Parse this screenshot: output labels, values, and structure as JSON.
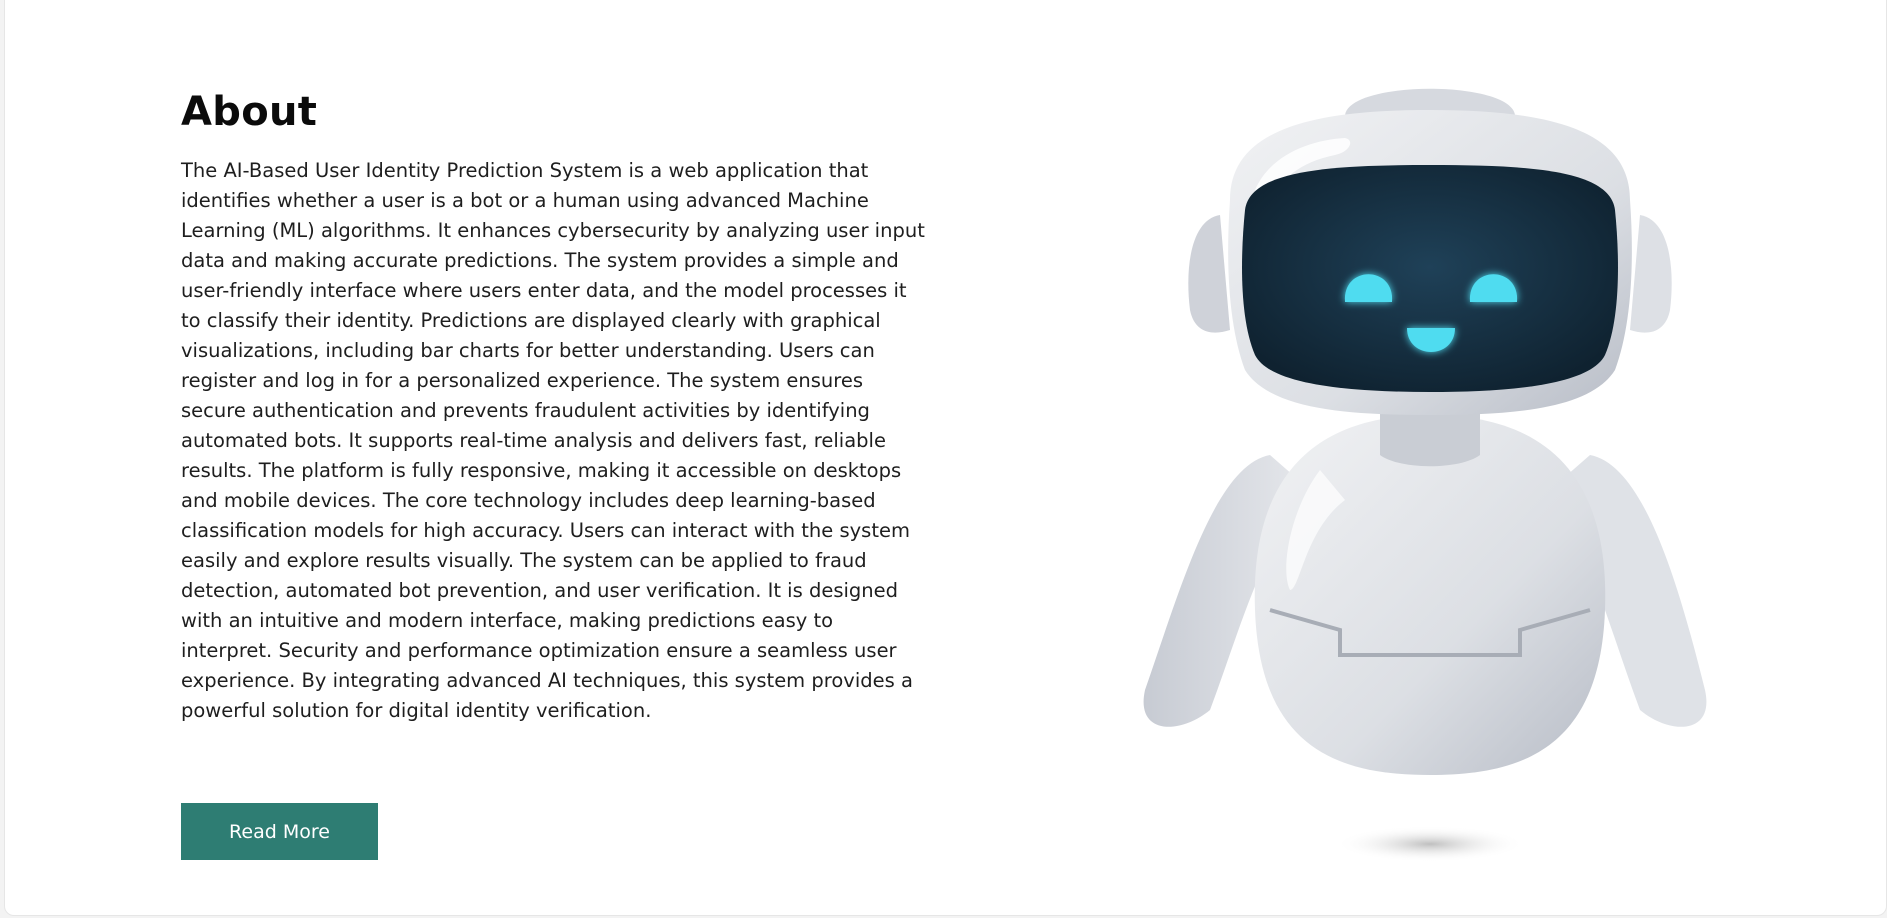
{
  "about": {
    "title": "About",
    "description": "The AI-Based User Identity Prediction System is a web application that identifies whether a user is a bot or a human using advanced Machine Learning (ML) algorithms. It enhances cybersecurity by analyzing user input data and making accurate predictions. The system provides a simple and user-friendly interface where users enter data, and the model processes it to classify their identity. Predictions are displayed clearly with graphical visualizations, including bar charts for better understanding. Users can register and log in for a personalized experience. The system ensures secure authentication and prevents fraudulent activities by identifying automated bots. It supports real-time analysis and delivers fast, reliable results. The platform is fully responsive, making it accessible on desktops and mobile devices. The core technology includes deep learning-based classification models for high accuracy. Users can interact with the system easily and explore results visually. The system can be applied to fraud detection, automated bot prevention, and user verification. It is designed with an intuitive and modern interface, making predictions easy to interpret. Security and performance optimization ensure a seamless user experience. By integrating advanced AI techniques, this system provides a powerful solution for digital identity verification.",
    "button_label": "Read More"
  },
  "illustration": {
    "icon": "robot-icon"
  },
  "colors": {
    "button_bg": "#2e7d73",
    "robot_eye": "#4fdcf0",
    "robot_visor": "#13293a",
    "robot_body": "#e4e6ea"
  }
}
